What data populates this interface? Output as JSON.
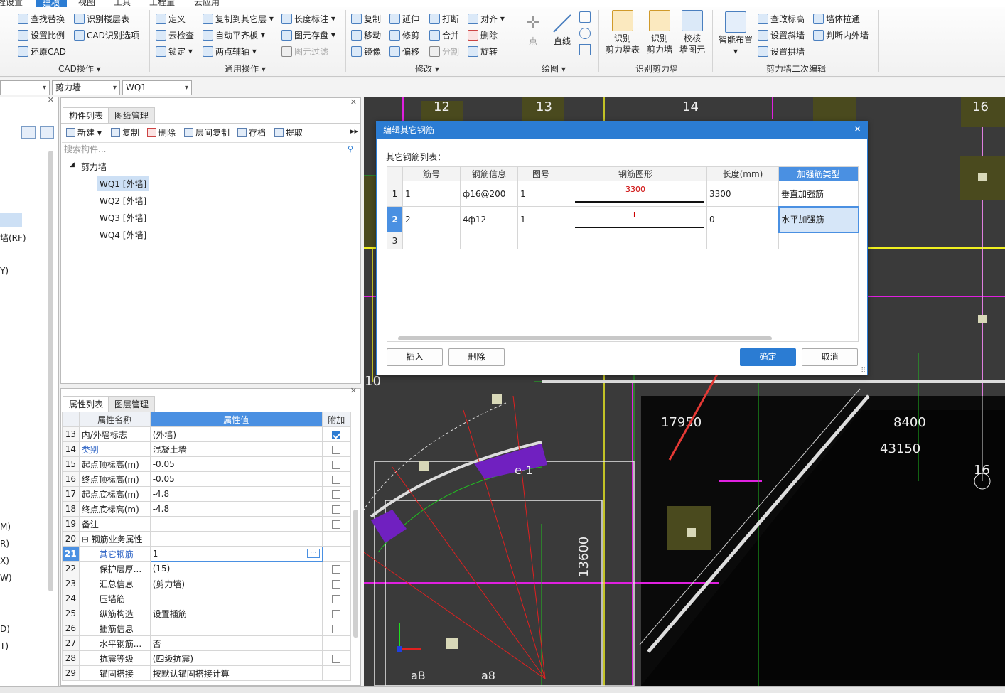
{
  "menubar": {
    "items": [
      "程设置",
      "建模",
      "视图",
      "工具",
      "工程量",
      "云应用"
    ],
    "active_index": 1
  },
  "ribbon": {
    "cad_ops": {
      "items": [
        "查找替换",
        "识别楼层表",
        "设置比例",
        "CAD识别选项",
        "还原CAD"
      ],
      "group_label": "CAD操作"
    },
    "general_ops": {
      "items": [
        "定义",
        "复制到其它层",
        "长度标注",
        "云检查",
        "自动平齐板",
        "图元存盘",
        "锁定",
        "两点辅轴",
        "图元过滤"
      ],
      "group_label": "通用操作"
    },
    "modify": {
      "items": [
        "复制",
        "延伸",
        "打断",
        "对齐",
        "移动",
        "修剪",
        "合并",
        "删除",
        "镜像",
        "偏移",
        "分割",
        "旋转"
      ],
      "group_label": "修改"
    },
    "draw": {
      "items": [
        "点",
        "直线"
      ],
      "group_label": "绘图"
    },
    "recognize": {
      "items": [
        "识别\n剪力墙表",
        "识别\n剪力墙",
        "校核\n墙图元"
      ],
      "group_label": "识别剪力墙"
    },
    "secondary": {
      "items": [
        "智能布置",
        "查改标高",
        "墙体拉通",
        "设置斜墙",
        "判断内外墙",
        "设置拱墙"
      ],
      "group_label": "剪力墙二次编辑"
    }
  },
  "toolbar2": {
    "combo1": "",
    "combo2": "剪力墙",
    "combo3": "WQ1"
  },
  "left_strip": {
    "items": [
      "墙(RF)",
      "Y)",
      "M)",
      "R)",
      "X)",
      "W)",
      "D)",
      "T)"
    ]
  },
  "component_panel": {
    "tabs": [
      "构件列表",
      "图纸管理"
    ],
    "toolbar": [
      "新建",
      "复制",
      "删除",
      "层间复制",
      "存档",
      "提取"
    ],
    "search_placeholder": "搜索构件...",
    "tree_root": "剪力墙",
    "items": [
      "WQ1 [外墙]",
      "WQ2 [外墙]",
      "WQ3 [外墙]",
      "WQ4 [外墙]"
    ]
  },
  "property_panel": {
    "tabs": [
      "属性列表",
      "图层管理"
    ],
    "headers": [
      "属性名称",
      "属性值",
      "附加"
    ],
    "rows": [
      {
        "n": "13",
        "name": "内/外墙标志",
        "value": "(外墙)",
        "check": "on"
      },
      {
        "n": "14",
        "name": "类别",
        "value": "混凝土墙",
        "check": "off"
      },
      {
        "n": "15",
        "name": "起点顶标高(m)",
        "value": "-0.05",
        "check": "off"
      },
      {
        "n": "16",
        "name": "终点顶标高(m)",
        "value": "-0.05",
        "check": "off"
      },
      {
        "n": "17",
        "name": "起点底标高(m)",
        "value": "-4.8",
        "check": "off"
      },
      {
        "n": "18",
        "name": "终点底标高(m)",
        "value": "-4.8",
        "check": "off"
      },
      {
        "n": "19",
        "name": "备注",
        "value": "",
        "check": "off"
      },
      {
        "n": "20",
        "name": "⊟ 钢筋业务属性",
        "value": "",
        "check": "none"
      },
      {
        "n": "21",
        "name": "其它钢筋",
        "value": "1",
        "check": "none"
      },
      {
        "n": "22",
        "name": "保护层厚...",
        "value": "(15)",
        "check": "off"
      },
      {
        "n": "23",
        "name": "汇总信息",
        "value": "(剪力墙)",
        "check": "off"
      },
      {
        "n": "24",
        "name": "压墙筋",
        "value": "",
        "check": "off"
      },
      {
        "n": "25",
        "name": "纵筋构造",
        "value": "设置插筋",
        "check": "off"
      },
      {
        "n": "26",
        "name": "插筋信息",
        "value": "",
        "check": "off"
      },
      {
        "n": "27",
        "name": "水平钢筋...",
        "value": "否",
        "check": "none"
      },
      {
        "n": "28",
        "name": "抗震等级",
        "value": "(四级抗震)",
        "check": "off"
      },
      {
        "n": "29",
        "name": "锚固搭接",
        "value": "按默认锚固搭接计算",
        "check": "none"
      }
    ]
  },
  "dialog": {
    "title": "编辑其它钢筋",
    "list_label": "其它钢筋列表：",
    "headers": [
      "筋号",
      "钢筋信息",
      "图号",
      "钢筋图形",
      "长度(mm)",
      "加强筋类型"
    ],
    "rows": [
      {
        "n": "1",
        "bar_no": "1",
        "info": "ф16@200",
        "fig": "1",
        "shape": "3300",
        "length": "3300",
        "type": "垂直加强筋"
      },
      {
        "n": "2",
        "bar_no": "2",
        "info": "4ф12",
        "fig": "1",
        "shape": "L",
        "length": "0",
        "type": "水平加强筋"
      },
      {
        "n": "3",
        "bar_no": "",
        "info": "",
        "fig": "",
        "shape": "",
        "length": "",
        "type": ""
      }
    ],
    "btn_insert": "插入",
    "btn_delete": "删除",
    "btn_ok": "确定",
    "btn_cancel": "取消"
  },
  "cad": {
    "axis_labels": [
      "12",
      "13",
      "14",
      "16",
      "10",
      "16"
    ],
    "dims": [
      "17950",
      "8400",
      "43150",
      "13600",
      "e-1"
    ],
    "bottom_labels": [
      "aB",
      "a8"
    ]
  },
  "colors": {
    "accent": "#2b7cd3",
    "cad_bg": "#3a3a3a",
    "magenta": "#e020e0",
    "yellow": "#f0f020",
    "arrow": "#e53935"
  }
}
